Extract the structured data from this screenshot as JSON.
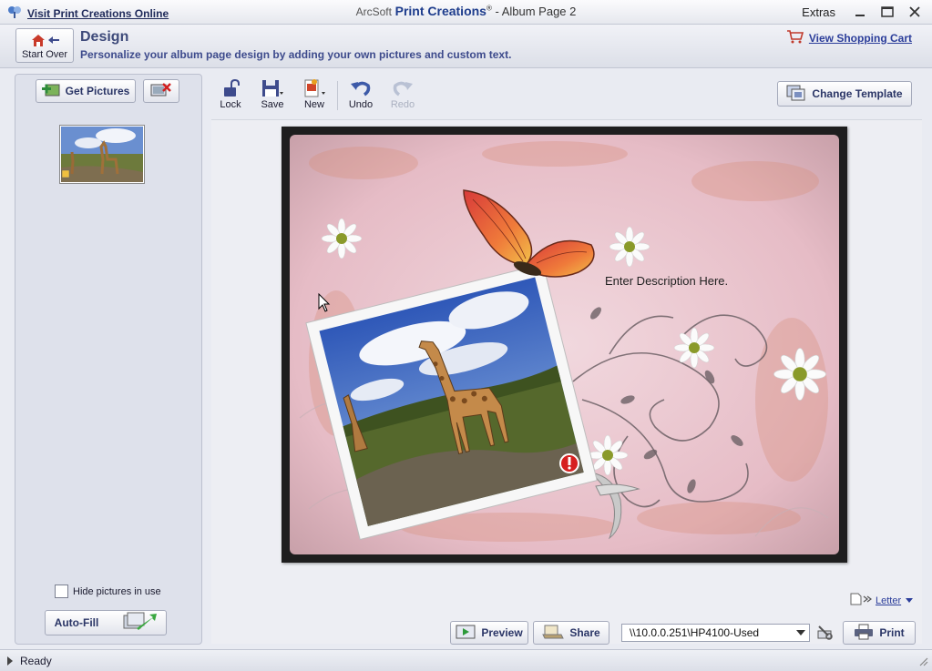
{
  "titlebar": {
    "visit_link": "Visit Print Creations Online",
    "brand": "ArcSoft",
    "product": "Print Creations",
    "registered": "®",
    "doc_title": " - Album Page 2",
    "extras": "Extras"
  },
  "header": {
    "start_over": "Start Over",
    "title": "Design",
    "subtitle": "Personalize your album page design by adding your own pictures and custom text.",
    "cart_link": "View Shopping Cart"
  },
  "left_panel": {
    "get_pictures": "Get Pictures",
    "hide_pictures": "Hide pictures in use",
    "auto_fill": "Auto-Fill"
  },
  "toolbar": {
    "lock": "Lock",
    "save": "Save",
    "new": "New",
    "undo": "Undo",
    "redo": "Redo",
    "change_template": "Change Template"
  },
  "canvas": {
    "description": "Enter Description Here."
  },
  "bottom": {
    "paper_size": "Letter",
    "preview": "Preview",
    "share": "Share",
    "printer": "\\\\10.0.0.251\\HP4100-Used",
    "print": "Print"
  },
  "status": {
    "text": "Ready"
  },
  "colors": {
    "accent": "#2b3d9a",
    "page_background": "#e8c6cf",
    "panel": "#dee1eb"
  }
}
